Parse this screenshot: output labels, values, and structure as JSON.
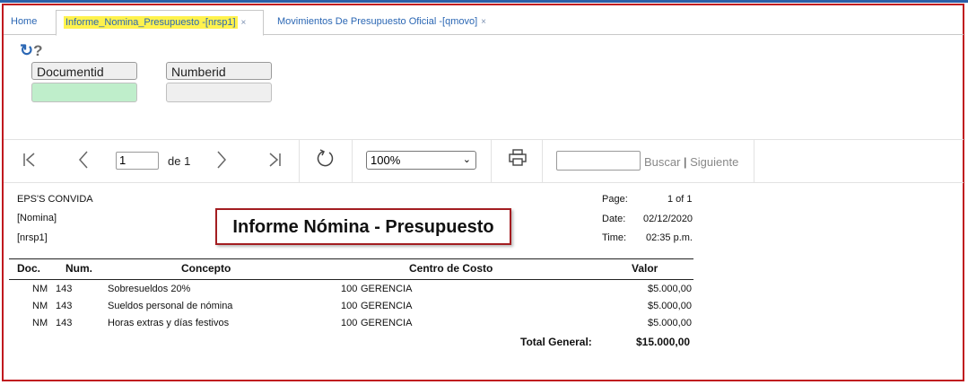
{
  "tabs": {
    "home": "Home",
    "active": "Informe_Nomina_Presupuesto -[nrsp1]",
    "other": "Movimientos De Presupuesto Oficial -[qmovo]",
    "close_glyph": "×"
  },
  "params": {
    "documentid_label": "Documentid",
    "documentid_value": "",
    "numberid_label": "Numberid",
    "numberid_value": ""
  },
  "toolbar": {
    "page_value": "1",
    "page_of": "de 1",
    "zoom": "100%",
    "buscar": "Buscar",
    "sep": "|",
    "siguiente": "Siguiente"
  },
  "report": {
    "company": "EPS'S CONVIDA",
    "category": "[Nomina]",
    "code": "[nrsp1]",
    "title": "Informe Nómina - Presupuesto",
    "page_label": "Page:",
    "page_value": "1 of 1",
    "date_label": "Date:",
    "date_value": "02/12/2020",
    "time_label": "Time:",
    "time_value": "02:35 p.m.",
    "headers": {
      "doc": "Doc.",
      "num": "Num.",
      "concepto": "Concepto",
      "centro": "Centro de Costo",
      "valor": "Valor"
    },
    "rows": [
      {
        "doc": "NM",
        "num": "143",
        "concepto": "Sobresueldos 20%",
        "cc_code": "100",
        "cc_name": "GERENCIA",
        "valor": "$5.000,00"
      },
      {
        "doc": "NM",
        "num": "143",
        "concepto": "Sueldos personal de nómina",
        "cc_code": "100",
        "cc_name": "GERENCIA",
        "valor": "$5.000,00"
      },
      {
        "doc": "NM",
        "num": "143",
        "concepto": "Horas extras y días festivos",
        "cc_code": "100",
        "cc_name": "GERENCIA",
        "valor": "$5.000,00"
      }
    ],
    "total_label": "Total General:",
    "total_value": "$15.000,00"
  },
  "icons": {
    "refresh": "refresh-icon",
    "help": "help-icon",
    "first": "first-page-icon",
    "prev": "prev-page-icon",
    "next": "next-page-icon",
    "last": "last-page-icon",
    "reload": "reload-icon",
    "print": "print-icon"
  },
  "colors": {
    "highlight": "#fff24d",
    "frame": "#c0191f",
    "link": "#2b67b4",
    "documentid_field": "#bfeecb"
  }
}
